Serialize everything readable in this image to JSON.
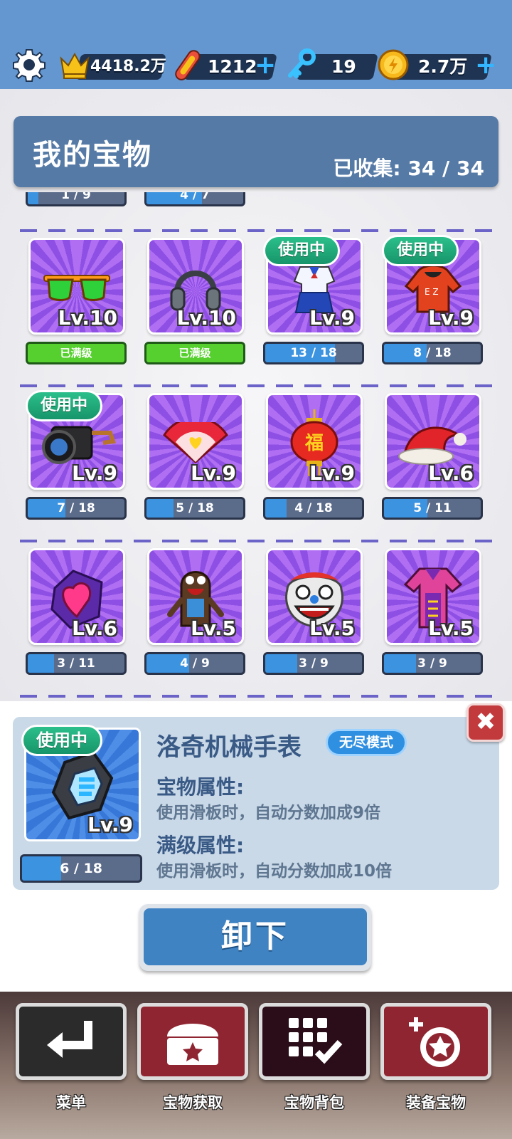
{
  "colors": {
    "sky": "#6497cf",
    "accent_blue": "#3c93e0",
    "in_use_green": "#2bbf8b",
    "max_green": "#56d02e",
    "close_red": "#c23a3c"
  },
  "hud": {
    "settings_icon": "gear-icon",
    "crown": {
      "icon": "crown-icon",
      "value": "4418.2万"
    },
    "skateboard": {
      "icon": "skateboard-icon",
      "value": "1212"
    },
    "keys": {
      "icon": "key-icon",
      "value": "19"
    },
    "coins": {
      "icon": "coin-icon",
      "value": "2.7万"
    }
  },
  "panel": {
    "title": "我的宝物",
    "collected": "已收集: 34 / 34"
  },
  "top_partial_bars": [
    {
      "text": "1 / 9",
      "progress": 0.11
    },
    {
      "text": "4 / 7",
      "progress": 0.57
    }
  ],
  "in_use_label": "使用中",
  "max_label": "已满级",
  "rows": [
    [
      {
        "name": "sunglasses",
        "icon": "sunglasses-icon",
        "level": "Lv.10",
        "in_use": false,
        "max": true,
        "progress_text": "已满级",
        "progress": 1
      },
      {
        "name": "headphones",
        "icon": "headphones-icon",
        "level": "Lv.10",
        "in_use": false,
        "max": true,
        "progress_text": "已满级",
        "progress": 1
      },
      {
        "name": "school-uniform",
        "icon": "uniform-icon",
        "level": "Lv.9",
        "in_use": true,
        "max": false,
        "progress_text": "13 / 18",
        "progress": 0.72
      },
      {
        "name": "red-hoodie",
        "icon": "hoodie-icon",
        "level": "Lv.9",
        "in_use": true,
        "max": false,
        "progress_text": "8 / 18",
        "progress": 0.44
      }
    ],
    [
      {
        "name": "camera",
        "icon": "camera-icon",
        "level": "Lv.9",
        "in_use": true,
        "max": false,
        "progress_text": "7 / 18",
        "progress": 0.39
      },
      {
        "name": "heart-fan",
        "icon": "fan-icon",
        "level": "Lv.9",
        "in_use": false,
        "max": false,
        "progress_text": "5 / 18",
        "progress": 0.28
      },
      {
        "name": "red-lantern",
        "icon": "lantern-icon",
        "level": "Lv.9",
        "in_use": false,
        "max": false,
        "progress_text": "4 / 18",
        "progress": 0.22
      },
      {
        "name": "santa-hat",
        "icon": "santa-hat-icon",
        "level": "Lv.6",
        "in_use": false,
        "max": false,
        "progress_text": "5 / 11",
        "progress": 0.45
      }
    ],
    [
      {
        "name": "heart-gem",
        "icon": "gem-icon",
        "level": "Lv.6",
        "in_use": false,
        "max": false,
        "progress_text": "3 / 11",
        "progress": 0.27
      },
      {
        "name": "plush-toy",
        "icon": "plush-icon",
        "level": "Lv.5",
        "in_use": false,
        "max": false,
        "progress_text": "4 / 9",
        "progress": 0.44
      },
      {
        "name": "lion-head",
        "icon": "lion-dance-icon",
        "level": "Lv.5",
        "in_use": false,
        "max": false,
        "progress_text": "3 / 9",
        "progress": 0.33
      },
      {
        "name": "pink-outfit",
        "icon": "outfit-icon",
        "level": "Lv.5",
        "in_use": false,
        "max": false,
        "progress_text": "3 / 9",
        "progress": 0.33
      }
    ]
  ],
  "detail": {
    "in_use": "使用中",
    "icon": "watch-icon",
    "level": "Lv.9",
    "progress_text": "6 / 18",
    "progress": 0.33,
    "name": "洛奇机械手表",
    "mode": "无尽模式",
    "attr_heading": "宝物属性:",
    "attr_text": "使用滑板时，自动分数加成9倍",
    "max_heading": "满级属性:",
    "max_text": "使用滑板时，自动分数加成10倍",
    "close_icon": "close-icon",
    "close_symbol": "✖"
  },
  "unequip_label": "卸下",
  "nav": [
    {
      "label": "菜单",
      "icon": "return-arrow-icon"
    },
    {
      "label": "宝物获取",
      "icon": "treasure-chest-icon"
    },
    {
      "label": "宝物背包",
      "icon": "grid-check-icon"
    },
    {
      "label": "装备宝物",
      "icon": "equip-star-icon"
    }
  ]
}
